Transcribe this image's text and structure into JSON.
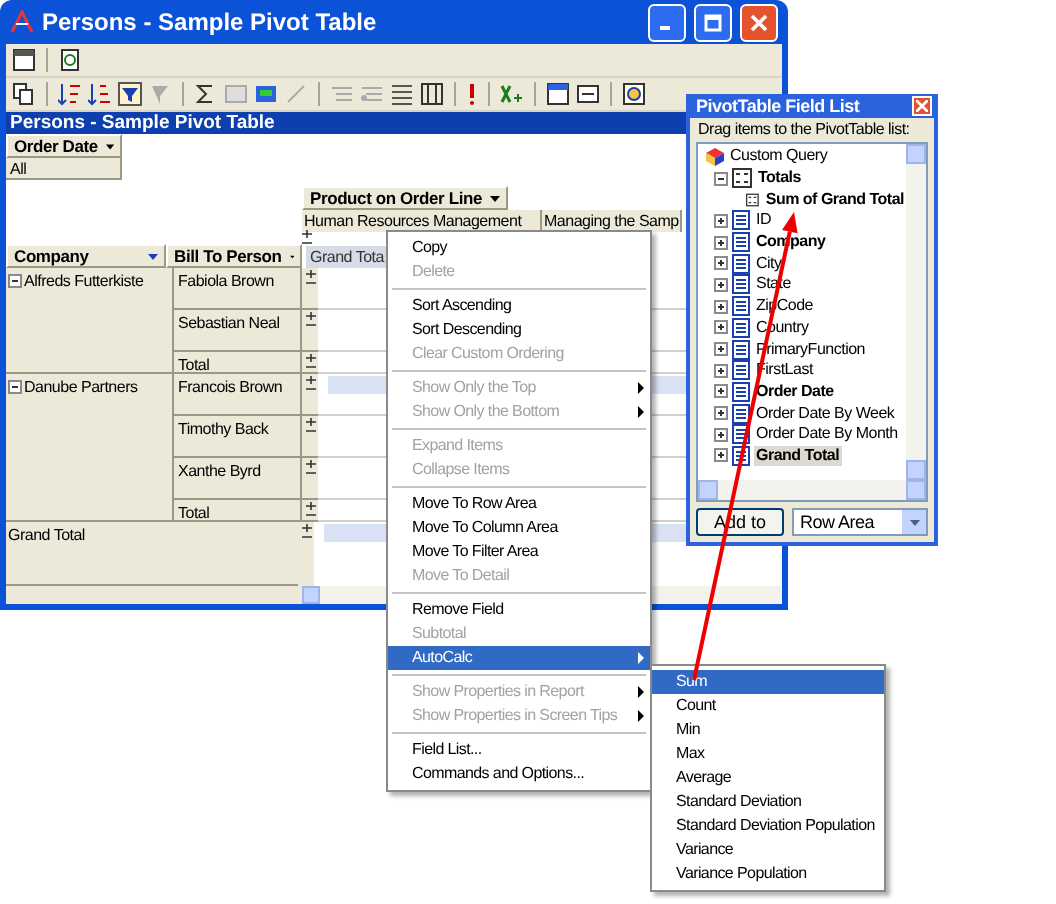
{
  "window": {
    "title": "Persons - Sample Pivot Table"
  },
  "pivot": {
    "title": "Persons - Sample Pivot Table",
    "filter_field": "Order Date",
    "filter_value": "All",
    "column_field": "Product on Order Line",
    "column_items": [
      "Human Resources Management",
      "Managing the Samp"
    ],
    "row_fields": [
      "Company",
      "Bill To Person"
    ],
    "data_header": "Grand Tota",
    "groups": [
      {
        "company": "Alfreds Futterkiste",
        "expanded": true,
        "rows": [
          {
            "label": "Fabiola Brown",
            "kind": "person",
            "highlighted": false
          },
          {
            "label": "Sebastian Neal",
            "kind": "person",
            "highlighted": false
          },
          {
            "label": "Total",
            "kind": "total",
            "highlighted": false
          }
        ]
      },
      {
        "company": "Danube Partners",
        "expanded": true,
        "rows": [
          {
            "label": "Francois Brown",
            "kind": "person",
            "highlighted": true
          },
          {
            "label": "Timothy Back",
            "kind": "person",
            "highlighted": false
          },
          {
            "label": "Xanthe Byrd",
            "kind": "person",
            "highlighted": false
          },
          {
            "label": "Total",
            "kind": "total",
            "highlighted": false
          }
        ]
      }
    ],
    "grand_total": {
      "label": "Grand Total",
      "highlighted": true
    }
  },
  "context_menu": {
    "items": [
      {
        "kind": "item",
        "label": "Copy",
        "disabled": false,
        "submenu": false,
        "selected": false
      },
      {
        "kind": "item",
        "label": "Delete",
        "disabled": true,
        "submenu": false,
        "selected": false
      },
      {
        "kind": "separator"
      },
      {
        "kind": "item",
        "label": "Sort Ascending",
        "disabled": false,
        "submenu": false,
        "selected": false
      },
      {
        "kind": "item",
        "label": "Sort Descending",
        "disabled": false,
        "submenu": false,
        "selected": false
      },
      {
        "kind": "item",
        "label": "Clear Custom Ordering",
        "disabled": true,
        "submenu": false,
        "selected": false
      },
      {
        "kind": "separator"
      },
      {
        "kind": "item",
        "label": "Show Only the Top",
        "disabled": true,
        "submenu": true,
        "selected": false
      },
      {
        "kind": "item",
        "label": "Show Only the Bottom",
        "disabled": true,
        "submenu": true,
        "selected": false
      },
      {
        "kind": "separator"
      },
      {
        "kind": "item",
        "label": "Expand Items",
        "disabled": true,
        "submenu": false,
        "selected": false
      },
      {
        "kind": "item",
        "label": "Collapse Items",
        "disabled": true,
        "submenu": false,
        "selected": false
      },
      {
        "kind": "separator"
      },
      {
        "kind": "item",
        "label": "Move To Row Area",
        "disabled": false,
        "submenu": false,
        "selected": false
      },
      {
        "kind": "item",
        "label": "Move To Column Area",
        "disabled": false,
        "submenu": false,
        "selected": false
      },
      {
        "kind": "item",
        "label": "Move To Filter Area",
        "disabled": false,
        "submenu": false,
        "selected": false
      },
      {
        "kind": "item",
        "label": "Move To Detail",
        "disabled": true,
        "submenu": false,
        "selected": false
      },
      {
        "kind": "separator"
      },
      {
        "kind": "item",
        "label": "Remove Field",
        "disabled": false,
        "submenu": false,
        "selected": false
      },
      {
        "kind": "item",
        "label": "Subtotal",
        "disabled": true,
        "submenu": false,
        "selected": false
      },
      {
        "kind": "item",
        "label": "AutoCalc",
        "disabled": false,
        "submenu": true,
        "selected": true
      },
      {
        "kind": "separator"
      },
      {
        "kind": "item",
        "label": "Show Properties in Report",
        "disabled": true,
        "submenu": true,
        "selected": false
      },
      {
        "kind": "item",
        "label": "Show Properties in Screen Tips",
        "disabled": true,
        "submenu": true,
        "selected": false
      },
      {
        "kind": "separator"
      },
      {
        "kind": "item",
        "label": "Field List...",
        "disabled": false,
        "submenu": false,
        "selected": false
      },
      {
        "kind": "item",
        "label": "Commands and Options...",
        "disabled": false,
        "submenu": false,
        "selected": false
      }
    ]
  },
  "submenu": {
    "items": [
      {
        "label": "Sum",
        "selected": true
      },
      {
        "label": "Count",
        "selected": false
      },
      {
        "label": "Min",
        "selected": false
      },
      {
        "label": "Max",
        "selected": false
      },
      {
        "label": "Average",
        "selected": false
      },
      {
        "label": "Standard Deviation",
        "selected": false
      },
      {
        "label": "Standard Deviation Population",
        "selected": false
      },
      {
        "label": "Variance",
        "selected": false
      },
      {
        "label": "Variance Population",
        "selected": false
      }
    ]
  },
  "field_list": {
    "title": "PivotTable Field List",
    "instruction": "Drag items to the PivotTable list:",
    "tree": [
      {
        "label": "Custom Query",
        "kind": "query",
        "bold": false,
        "selected": false,
        "children": [
          {
            "label": "Totals",
            "kind": "totals",
            "bold": true,
            "selected": false,
            "expanded": true,
            "children": [
              {
                "label": "Sum of Grand Total",
                "kind": "measure",
                "bold": true,
                "selected": false
              }
            ]
          },
          {
            "label": "ID",
            "kind": "field",
            "bold": false,
            "selected": false,
            "expanded": false
          },
          {
            "label": "Company",
            "kind": "field",
            "bold": true,
            "selected": false,
            "expanded": false
          },
          {
            "label": "City",
            "kind": "field",
            "bold": false,
            "selected": false,
            "expanded": false
          },
          {
            "label": "State",
            "kind": "field",
            "bold": false,
            "selected": false,
            "expanded": false
          },
          {
            "label": "ZipCode",
            "kind": "field",
            "bold": false,
            "selected": false,
            "expanded": false
          },
          {
            "label": "Country",
            "kind": "field",
            "bold": false,
            "selected": false,
            "expanded": false
          },
          {
            "label": "PrimaryFunction",
            "kind": "field",
            "bold": false,
            "selected": false,
            "expanded": false
          },
          {
            "label": "FirstLast",
            "kind": "field",
            "bold": false,
            "selected": false,
            "expanded": false
          },
          {
            "label": "Order Date",
            "kind": "field",
            "bold": true,
            "selected": false,
            "expanded": false
          },
          {
            "label": "Order Date By Week",
            "kind": "field",
            "bold": false,
            "selected": false,
            "expanded": false
          },
          {
            "label": "Order Date By Month",
            "kind": "field",
            "bold": false,
            "selected": false,
            "expanded": false
          },
          {
            "label": "Grand Total",
            "kind": "field",
            "bold": true,
            "selected": true,
            "expanded": false
          }
        ]
      }
    ],
    "add_button": "Add to",
    "area": "Row Area"
  }
}
